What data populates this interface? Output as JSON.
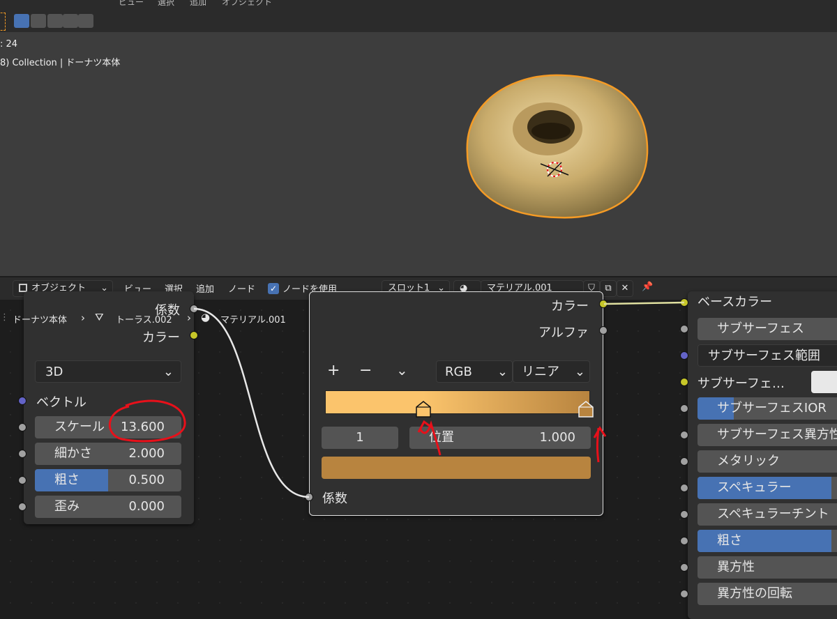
{
  "viewport": {
    "header_menu": [
      "ビュー",
      "選択",
      "追加",
      "オブジェクト"
    ],
    "frame_info": ": 24",
    "collection_info": "8) Collection | ドーナツ本体"
  },
  "node_header": {
    "editor_type": "オブジェクト",
    "menu": [
      "ビュー",
      "選択",
      "追加",
      "ノード"
    ],
    "use_nodes_label": "ノードを使用",
    "use_nodes_checked": true,
    "slot": "スロット1",
    "material_name": "マテリアル.001"
  },
  "breadcrumb": {
    "object": "ドーナツ本体",
    "mesh": "トーラス.002",
    "material": "マテリアル.001"
  },
  "noise_node": {
    "out_fac": "係数",
    "out_color": "カラー",
    "dimension": "3D",
    "vector_label": "ベクトル",
    "fields": [
      {
        "label": "スケール",
        "value": "13.600"
      },
      {
        "label": "細かさ",
        "value": "2.000"
      },
      {
        "label": "粗さ",
        "value": "0.500",
        "fill": 0.5
      },
      {
        "label": "歪み",
        "value": "0.000"
      }
    ]
  },
  "ramp_node": {
    "out_color": "カラー",
    "out_alpha": "アルファ",
    "add_symbol": "+",
    "remove_symbol": "−",
    "color_mode": "RGB",
    "interpolation": "リニア",
    "stop_index": "1",
    "position_label": "位置",
    "position_value": "1.000",
    "in_fac": "係数",
    "stop_color": "#b8843f",
    "ramp_start_color": "#fbc46c",
    "ramp_end_color": "#b8843f"
  },
  "principled_node": {
    "base_color_label": "ベースカラー",
    "rows": [
      {
        "label": "サブサーフェス",
        "socket": "grey",
        "style": "field"
      },
      {
        "label": "サブサーフェス範囲",
        "socket": "pur",
        "style": "dropdown"
      },
      {
        "label": "サブサーフェ…",
        "socket": "yel",
        "style": "color"
      },
      {
        "label": "サブサーフェスIOR",
        "socket": "grey",
        "style": "partial"
      },
      {
        "label": "サブサーフェス異方性",
        "socket": "grey",
        "style": "field"
      },
      {
        "label": "メタリック",
        "socket": "grey",
        "style": "field"
      },
      {
        "label": "スペキュラー",
        "socket": "grey",
        "style": "full"
      },
      {
        "label": "スペキュラーチント",
        "socket": "grey",
        "style": "field"
      },
      {
        "label": "粗さ",
        "socket": "grey",
        "style": "full"
      },
      {
        "label": "異方性",
        "socket": "grey",
        "style": "field"
      },
      {
        "label": "異方性の回転",
        "socket": "grey",
        "style": "field"
      }
    ]
  },
  "colors": {
    "accent_blue": "#4772b3",
    "selection_orange": "#f59b25",
    "annotation_red": "#e8101a"
  }
}
